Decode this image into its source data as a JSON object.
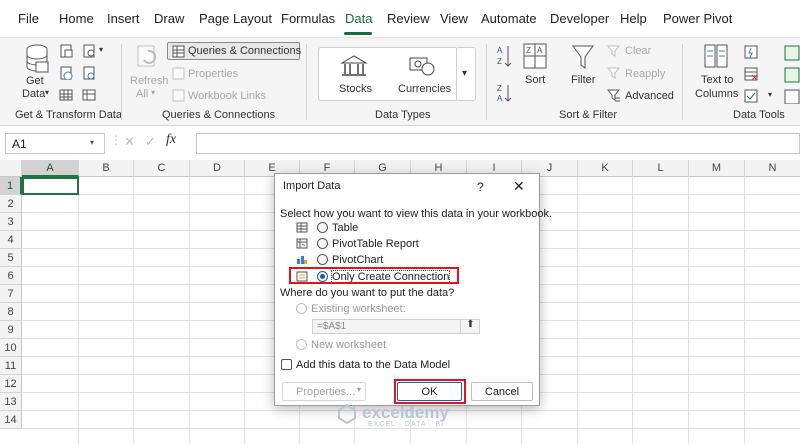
{
  "menu": [
    "File",
    "Home",
    "Insert",
    "Draw",
    "Page Layout",
    "Formulas",
    "Data",
    "Review",
    "View",
    "Automate",
    "Developer",
    "Help",
    "Power Pivot"
  ],
  "ribbon": {
    "get_data": "Get",
    "get_data2": "Data",
    "get_group": "Get & Transform Data",
    "refresh": "Refresh",
    "refresh_all": "All",
    "queries_connections": "Queries & Connections",
    "properties": "Properties",
    "workbook_links": "Workbook Links",
    "qc_group": "Queries & Connections",
    "stocks": "Stocks",
    "currencies": "Currencies",
    "dt_group": "Data Types",
    "sort": "Sort",
    "filter": "Filter",
    "clear": "Clear",
    "reapply": "Reapply",
    "advanced": "Advanced",
    "sf_group": "Sort & Filter",
    "text_to": "Text to",
    "columns": "Columns",
    "tools_group": "Data Tools"
  },
  "formula_bar": {
    "name_box": "A1",
    "fx": "fx"
  },
  "grid": {
    "columns": [
      "A",
      "B",
      "C",
      "D",
      "E",
      "F",
      "G",
      "H",
      "I",
      "J",
      "K",
      "L",
      "M",
      "N"
    ],
    "rows": [
      "1",
      "2",
      "3",
      "4",
      "5",
      "6",
      "7",
      "8",
      "9",
      "10",
      "11",
      "12",
      "13",
      "14"
    ]
  },
  "dialog": {
    "title": "Import Data",
    "help": "?",
    "close": "✕",
    "prompt": "Select how you want to view this data in your workbook.",
    "options": [
      "Table",
      "PivotTable Report",
      "PivotChart",
      "Only Create Connection"
    ],
    "location_prompt": "Where do you want to put the data?",
    "existing": "Existing worksheet:",
    "ref": "=$A$1",
    "new_ws": "New worksheet",
    "data_model": "Add this data to the Data Model",
    "properties": "Properties...",
    "ok": "OK",
    "cancel": "Cancel"
  },
  "watermark": {
    "brand": "exceldemy",
    "tagline": "EXCEL · DATA · BI"
  },
  "colors": {
    "accent": "#217346",
    "highlight": "#e0141b",
    "radio": "#1e5aa8"
  }
}
